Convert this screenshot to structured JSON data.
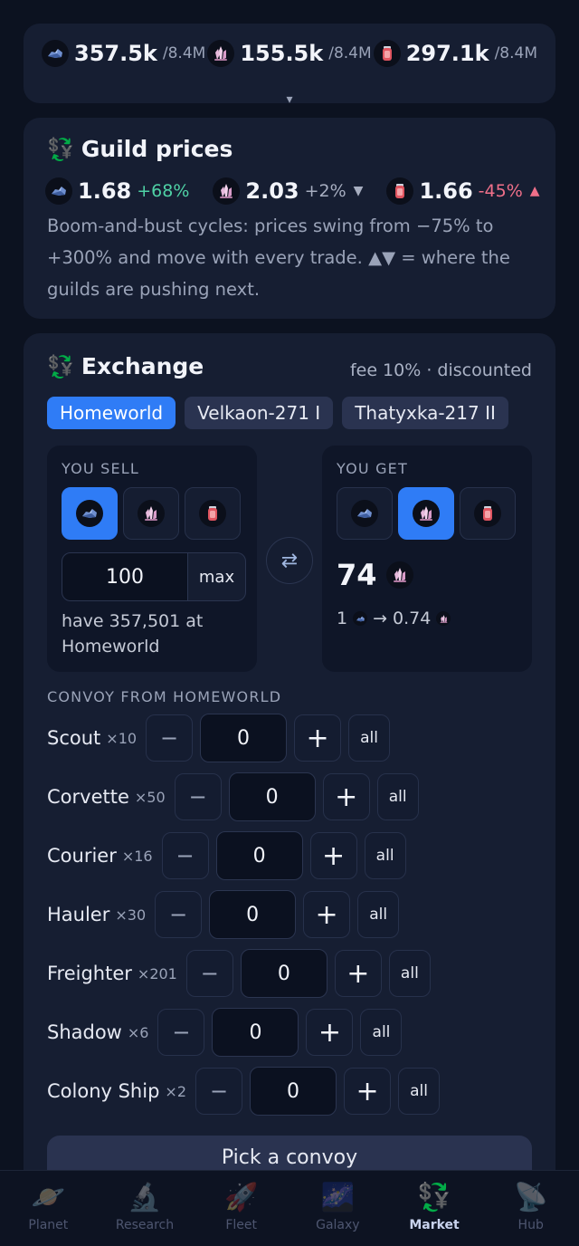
{
  "resources": [
    {
      "icon": "ore-icon",
      "value": "357.5k",
      "cap": "/8.4M"
    },
    {
      "icon": "crystal-icon",
      "value": "155.5k",
      "cap": "/8.4M"
    },
    {
      "icon": "fuel-canister-icon",
      "value": "297.1k",
      "cap": "/8.4M"
    }
  ],
  "resources_expand": "▾",
  "guild": {
    "icon": "💱",
    "title": "Guild prices",
    "prices": [
      {
        "icon": "ore-icon",
        "value": "1.68",
        "change": "+68%",
        "trend": "up",
        "pointer": ""
      },
      {
        "icon": "crystal-icon",
        "value": "2.03",
        "change": "+2%",
        "trend": "neutral",
        "pointer": "▼"
      },
      {
        "icon": "fuel-canister-icon",
        "value": "1.66",
        "change": "-45%",
        "trend": "down",
        "pointer": "▲"
      }
    ],
    "description": "Boom-and-bust cycles: prices swing from −75% to +300% and move with every trade. ▲▼ = where the guilds are pushing next."
  },
  "exchange": {
    "icon": "💱",
    "title": "Exchange",
    "fee": "fee 10% · discounted",
    "locations": [
      "Homeworld",
      "Velkaon-271 I",
      "Thatyxka-217 II"
    ],
    "active_location": 0,
    "sell": {
      "label": "YOU SELL",
      "selected": 0,
      "amount": "100",
      "max_label": "max",
      "have": "have 357,501 at Homeworld"
    },
    "swap_icon": "⇄",
    "get": {
      "label": "YOU GET",
      "selected": 1,
      "amount": "74",
      "rate_from": "1",
      "rate_arrow": "→",
      "rate_to": "0.74"
    },
    "convoy_label": "CONVOY FROM HOMEWORLD",
    "ships": [
      {
        "name": "Scout",
        "count": "×10",
        "qty": "0"
      },
      {
        "name": "Corvette",
        "count": "×50",
        "qty": "0"
      },
      {
        "name": "Courier",
        "count": "×16",
        "qty": "0"
      },
      {
        "name": "Hauler",
        "count": "×30",
        "qty": "0"
      },
      {
        "name": "Freighter",
        "count": "×201",
        "qty": "0"
      },
      {
        "name": "Shadow",
        "count": "×6",
        "qty": "0"
      },
      {
        "name": "Colony Ship",
        "count": "×2",
        "qty": "0"
      }
    ],
    "minus": "−",
    "plus": "+",
    "all_label": "all",
    "pick_button": "Pick a convoy"
  },
  "nav": [
    {
      "label": "Planet",
      "icon": "🪐",
      "name": "planet-icon",
      "active": false
    },
    {
      "label": "Research",
      "icon": "🔬",
      "name": "microscope-icon",
      "active": false
    },
    {
      "label": "Fleet",
      "icon": "🚀",
      "name": "rocket-icon",
      "active": false
    },
    {
      "label": "Galaxy",
      "icon": "🌌",
      "name": "galaxy-icon",
      "active": false
    },
    {
      "label": "Market",
      "icon": "💱",
      "name": "currency-exchange-icon",
      "active": true
    },
    {
      "label": "Hub",
      "icon": "📡",
      "name": "satellite-dish-icon",
      "active": false
    }
  ],
  "colors": {
    "accent": "#2f7cf6",
    "up": "#4fd1a5",
    "down": "#f0708a",
    "card": "#161e32",
    "bg": "#0c1220"
  }
}
